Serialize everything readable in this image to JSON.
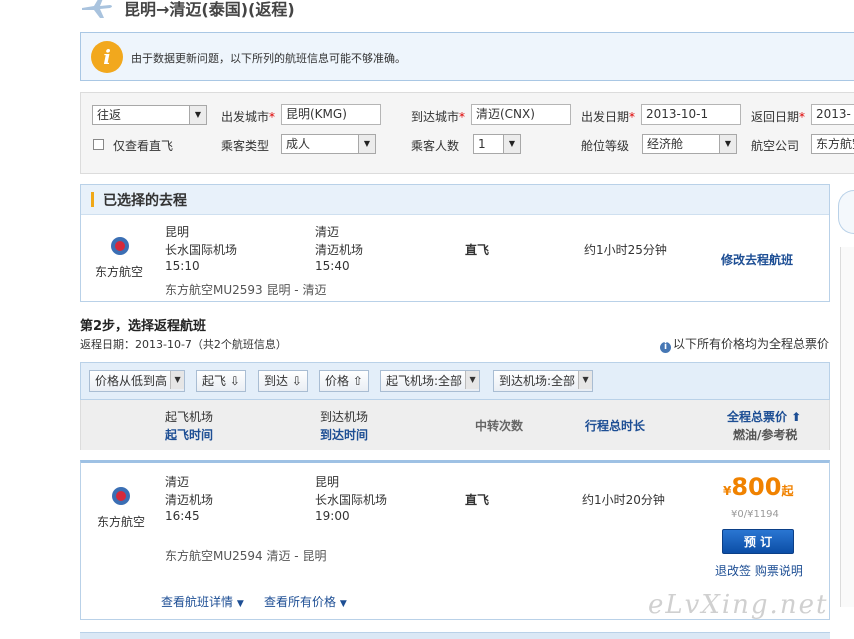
{
  "header": {
    "title": "昆明→清迈(泰国)(返程)"
  },
  "notice": {
    "icon_char": "i",
    "text": "由于数据更新问题，以下所列的航班信息可能不够准确。"
  },
  "search": {
    "trip_type": "往返",
    "direct_only_label": "仅查看直飞",
    "from_label": "出发城市",
    "from_value": "昆明(KMG)",
    "to_label": "到达城市",
    "to_value": "清迈(CNX)",
    "depart_label": "出发日期",
    "depart_value": "2013-10-1",
    "return_label": "返回日期",
    "return_value": "2013-",
    "pax_type_label": "乘客类型",
    "pax_type_value": "成人",
    "pax_count_label": "乘客人数",
    "pax_count_value": "1",
    "cabin_label": "舱位等级",
    "cabin_value": "经济舱",
    "airline_label": "航空公司",
    "airline_value": "东方航空",
    "required_mark": "*"
  },
  "selected_outbound": {
    "title": "已选择的去程",
    "airline": "东方航空",
    "dep_city": "昆明",
    "dep_airport": "长水国际机场",
    "dep_time": "15:10",
    "arr_city": "清迈",
    "arr_airport": "清迈机场",
    "arr_time": "15:40",
    "stops": "直飞",
    "duration": "约1小时25分钟",
    "flight": "东方航空MU2593  昆明 - 清迈",
    "modify_link": "修改去程航班"
  },
  "step": {
    "title": "第2步，选择返程航班",
    "date_line": "返程日期：2013-10-7（共2个航班信息）",
    "price_note": "以下所有价格均为全程总票价"
  },
  "filters": {
    "sort": "价格从低到高",
    "depart": "起飞 ⇩",
    "arrive": "到达 ⇩",
    "price": "价格 ⇧",
    "dep_airport": "起飞机场:全部",
    "arr_airport": "到达机场:全部"
  },
  "columns": {
    "dep_airport": "起飞机场",
    "dep_time": "起飞时间",
    "arr_airport": "到达机场",
    "arr_time": "到达时间",
    "stops": "中转次数",
    "duration": "行程总时长",
    "total_price": "全程总票价",
    "tax": "燃油/参考税"
  },
  "result": {
    "airline": "东方航空",
    "dep_city": "清迈",
    "dep_airport": "清迈机场",
    "dep_time": "16:45",
    "arr_city": "昆明",
    "arr_airport": "长水国际机场",
    "arr_time": "19:00",
    "stops": "直飞",
    "duration": "约1小时20分钟",
    "currency": "¥",
    "price": "800",
    "price_suffix": "起",
    "tax": "¥0/¥1194",
    "book": "预 订",
    "refund_rules": "退改签 购票说明",
    "flight": "东方航空MU2594  清迈 - 昆明",
    "details_link": "查看航班详情",
    "all_prices_link": "查看所有价格"
  },
  "watermark": "eLvXing.net",
  "colors": {
    "accent_orange": "#f08200",
    "link_blue": "#1d4e94",
    "panel_blue": "#e8f1fa"
  }
}
